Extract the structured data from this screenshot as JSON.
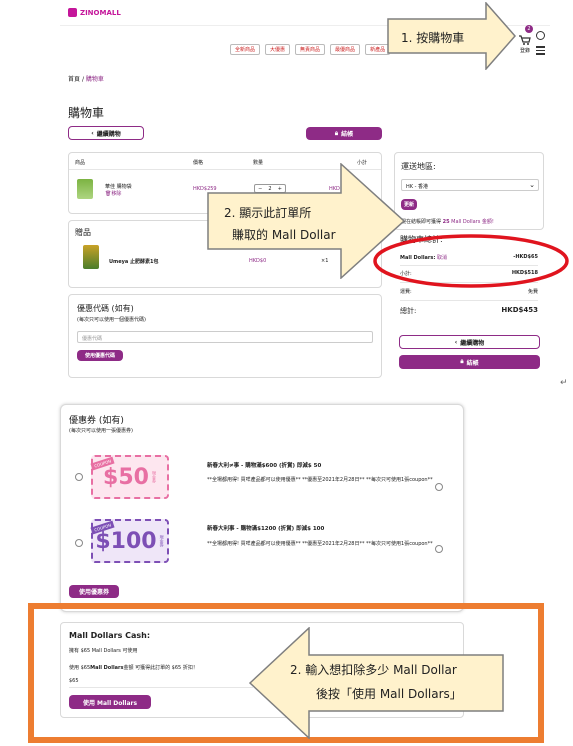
{
  "header": {
    "logo_text": "ZINOMALL",
    "nav_pills": [
      "全新商品",
      "大優惠",
      "無責商品",
      "最優商品",
      "新產品"
    ],
    "cart_count": "2",
    "login_label": "登錄"
  },
  "breadcrumb": {
    "home": "首頁",
    "sep": "/",
    "current": "購物車"
  },
  "page_title": "購物車",
  "buttons": {
    "continue_shopping": "繼續購物",
    "checkout": "結帳",
    "update": "更新",
    "use_coupon_code": "使用優惠代碼",
    "use_voucher": "使用優惠券",
    "use_mall_dollars": "使用 Mall Dollars"
  },
  "cart_table": {
    "headers": [
      "商品",
      "價格",
      "數量",
      "小計"
    ],
    "item": {
      "name": "華佳 購物袋",
      "remove": "移除",
      "price": "HKD$259",
      "qty": "2",
      "subtotal": "HKD"
    }
  },
  "gift": {
    "title": "贈品",
    "name": "Umeya 止肥酵素1包",
    "price": "HKD$0",
    "qty": "×1"
  },
  "coupon_code": {
    "title": "優惠代碼 (如有)",
    "note": "(每次只可以使用一個優惠代碼)",
    "placeholder": "優惠代碼"
  },
  "shipping": {
    "title": "運送地區:",
    "region": "HK - 香港",
    "earn_prefix": "現在結帳即可獲得",
    "earn_amount": "25",
    "earn_suffix": "Mall Dollars 金額!"
  },
  "summary": {
    "title": "購物車總計:",
    "mall_dollars_label": "Mall Dollars:",
    "cancel": "取消",
    "mall_dollars_value": "-HKD$65",
    "subtotal_label": "小計:",
    "subtotal_value": "HKD$518",
    "shipping_label": "運費:",
    "shipping_value": "免費",
    "total_label": "總計:",
    "total_value": "HKD$453"
  },
  "vouchers": {
    "title": "優惠券 (如有)",
    "note": "(每次只可以使用一張優惠券)",
    "items": [
      {
        "amount": "$50",
        "ribbon": "COUPON",
        "side": "現金券",
        "title": "新春大利≠事 - 購物滿$600 (折賞) 即減$ 50",
        "desc": "**全場都用得! 買咩產品都可以使用優惠** **優惠至2021年2月28日** **每次只可使用1張coupon**"
      },
      {
        "amount": "$100",
        "ribbon": "COUPON",
        "side": "現金券",
        "title": "新春大利事 - 購物滿$1200 (折賞) 即減$ 100",
        "desc": "**全場都用得! 買咩產品都可以使用優惠** **優惠至2021年2月28日** **每次只可使用1張coupon**"
      }
    ]
  },
  "mall_cash": {
    "title": "Mall Dollars Cash:",
    "have": "擁有 $65 Mall Dollars 可使用",
    "use_prefix": "使用 $65",
    "use_bold": "Mall Dollars",
    "use_suffix": "金額 可獲得此訂單的  $65 折扣！",
    "input_value": "$65"
  },
  "callouts": {
    "c1": "1.  按購物車",
    "c2_line1": "2.  顯示此訂單所",
    "c2_line2": "賺取的 Mall Dollar",
    "c3_line1": "2.  輸入想扣除多少 Mall Dollar",
    "c3_line2": "後按「使用 Mall Dollars」"
  },
  "doc_marks": {
    "return_mark": "↵"
  },
  "colors": {
    "brand": "#8e2b86",
    "highlight_ring": "#e0141e",
    "frame": "#ed7d31",
    "callout_fill": "#fff2cc"
  }
}
